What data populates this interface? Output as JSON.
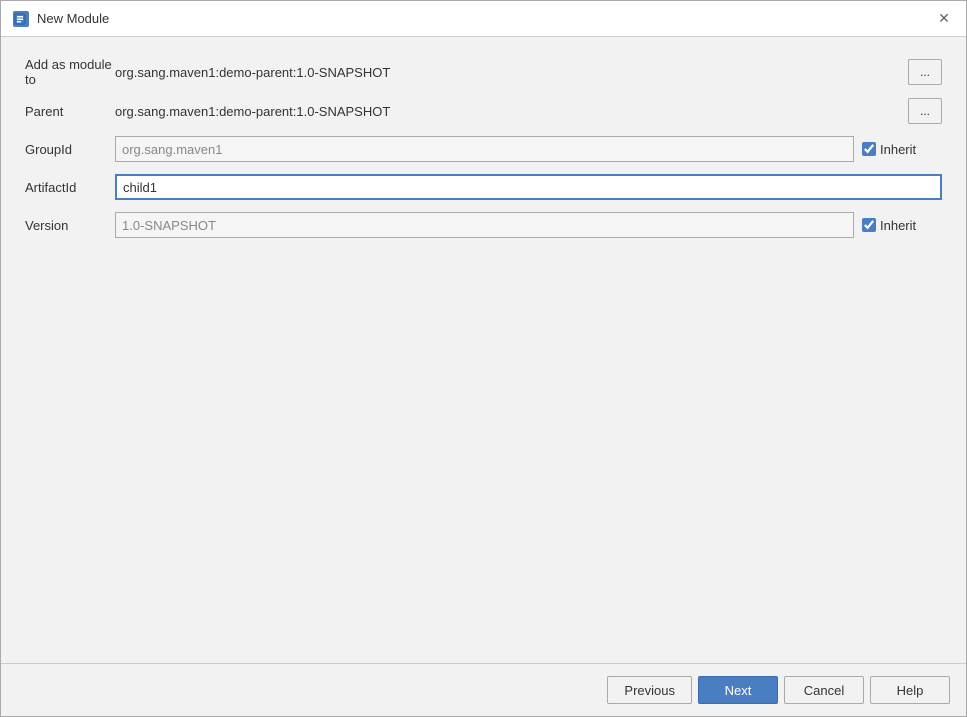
{
  "dialog": {
    "title": "New Module",
    "title_icon": "M"
  },
  "form": {
    "add_as_module_label": "Add as module to",
    "add_as_module_value": "org.sang.maven1:demo-parent:1.0-SNAPSHOT",
    "parent_label": "Parent",
    "parent_value": "org.sang.maven1:demo-parent:1.0-SNAPSHOT",
    "group_id_label": "GroupId",
    "group_id_value": "org.sang.maven1",
    "group_id_placeholder": "org.sang.maven1",
    "group_id_inherit": true,
    "artifact_id_label": "ArtifactId",
    "artifact_id_value": "child1",
    "version_label": "Version",
    "version_value": "1.0-SNAPSHOT",
    "version_placeholder": "1.0-SNAPSHOT",
    "version_inherit": true,
    "inherit_label": "Inherit",
    "browse_label": "..."
  },
  "footer": {
    "previous_label": "Previous",
    "next_label": "Next",
    "cancel_label": "Cancel",
    "help_label": "Help"
  }
}
